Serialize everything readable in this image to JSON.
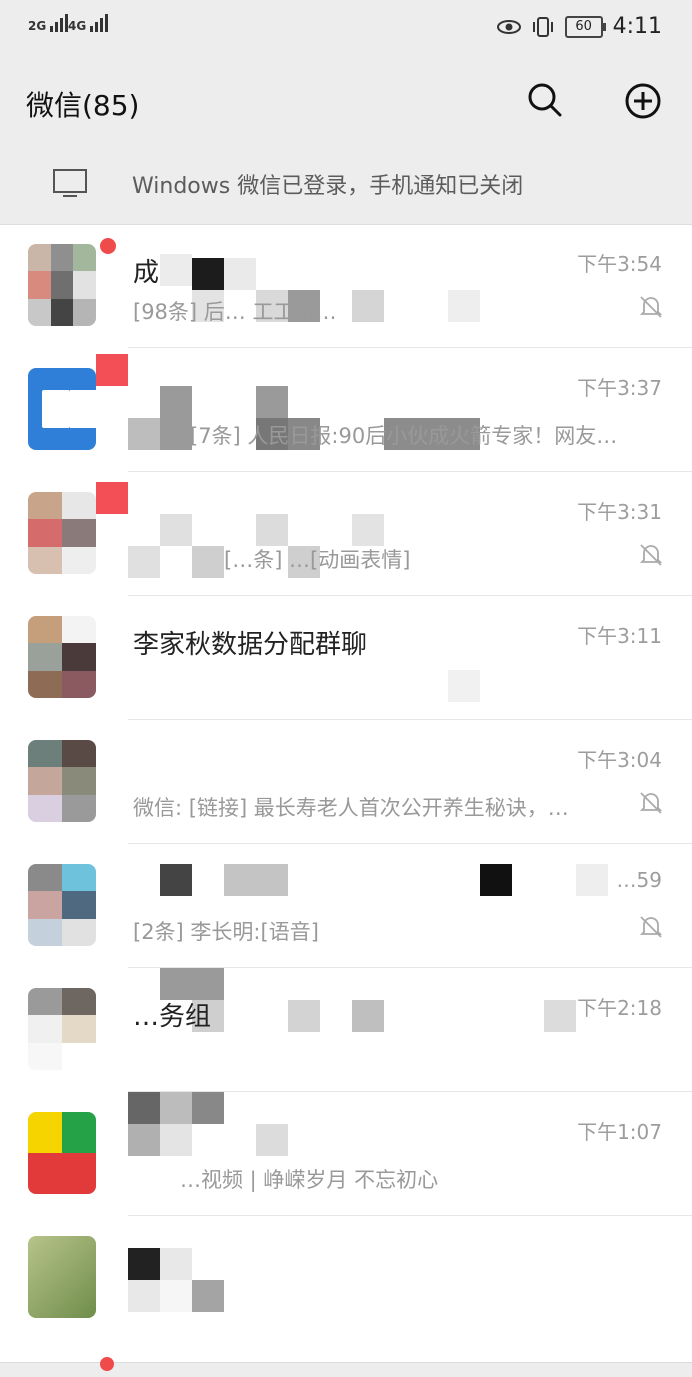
{
  "status_bar": {
    "signal_1": "2G",
    "signal_2": "4G",
    "battery": "60",
    "time": "4:11"
  },
  "header": {
    "title": "微信(85)",
    "search_icon": "search-icon",
    "add_icon": "plus-circle-icon"
  },
  "notice": {
    "icon": "monitor-icon",
    "text": "Windows 微信已登录，手机通知已关闭"
  },
  "chats": [
    {
      "name": "成",
      "preview": "[98条] 后…  工工资…",
      "time": "下午3:54",
      "muted": true,
      "unread_dot": true
    },
    {
      "name": "",
      "preview": "[7条] 人民日报:90后小伙成火箭专家！网友…",
      "time": "下午3:37",
      "muted": false,
      "unread_dot": false
    },
    {
      "name": "",
      "preview": "[…条] …[动画表情]",
      "time": "下午3:31",
      "muted": true,
      "unread_dot": false
    },
    {
      "name": "李家秋数据分配群聊",
      "preview": "",
      "time": "下午3:11",
      "muted": false,
      "unread_dot": false
    },
    {
      "name": "",
      "preview": "微信: [链接] 最长寿老人首次公开养生秘诀，…",
      "time": "下午3:04",
      "muted": true,
      "unread_dot": false
    },
    {
      "name": "",
      "preview": "[2条] 李长明:[语音]",
      "time": "…59",
      "muted": true,
      "unread_dot": false
    },
    {
      "name": "…务组",
      "preview": "",
      "time": "下午2:18",
      "muted": false,
      "unread_dot": false
    },
    {
      "name": "",
      "preview": "…视频 | 峥嵘岁月 不忘初心",
      "time": "下午1:07",
      "muted": false,
      "unread_dot": false
    },
    {
      "name": "",
      "preview": "",
      "time": "",
      "muted": false,
      "unread_dot": false
    }
  ],
  "colors": {
    "bar_bg": "#ededed",
    "badge_red": "#f04b4b",
    "text_gray": "#9d9d9d"
  }
}
